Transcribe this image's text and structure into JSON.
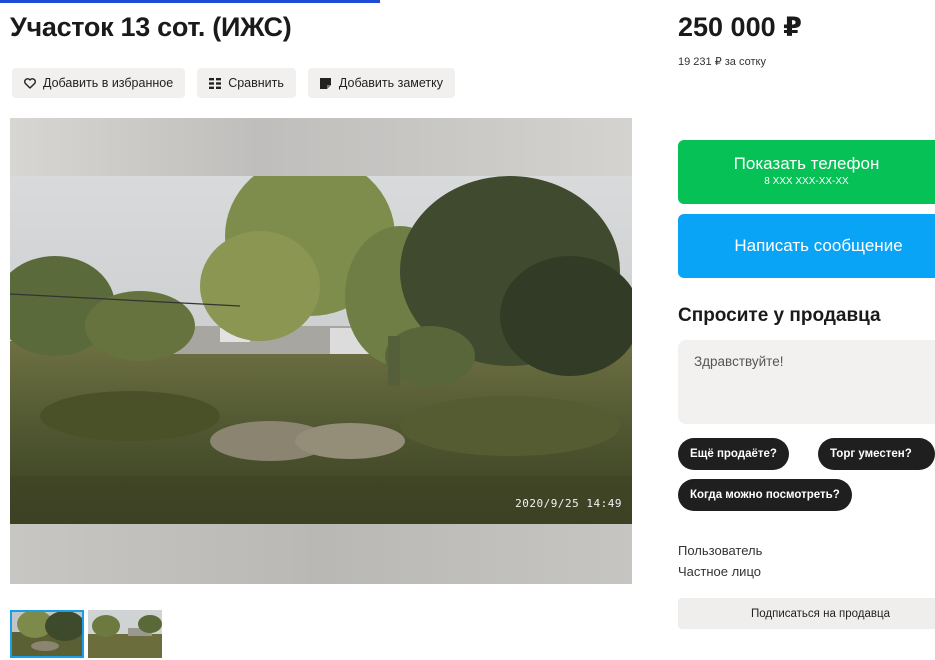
{
  "listing": {
    "title": "Участок 13 сот. (ИЖС)",
    "price": "250 000 ₽",
    "price_per_sotka": "19 231 ₽ за сотку"
  },
  "actions": {
    "favorite_label": "Добавить в избранное",
    "compare_label": "Сравнить",
    "note_label": "Добавить заметку"
  },
  "gallery": {
    "timestamp": "2020/9/25 14:49",
    "thumbnail_count": 2,
    "active_thumbnail": 1
  },
  "contact": {
    "show_phone_label": "Показать телефон",
    "phone_mask": "8 XXX XXX-XX-XX",
    "message_label": "Написать сообщение"
  },
  "ask": {
    "title": "Спросите у продавца",
    "input_value": "Здравствуйте!",
    "chips": [
      "Ещё продаёте?",
      "Торг уместен?",
      "Когда можно посмотреть?"
    ]
  },
  "seller": {
    "role": "Пользователь",
    "type": "Частное лицо",
    "subscribe_label": "Подписаться на продавца"
  },
  "colors": {
    "phone_button": "#06c155",
    "message_button": "#0aa4f6",
    "chip_bg": "#1f1f1f",
    "thumb_active_border": "#1a9ee8"
  },
  "icons": {
    "favorite": "heart-outline-icon",
    "compare": "compare-bars-icon",
    "note": "note-icon"
  }
}
